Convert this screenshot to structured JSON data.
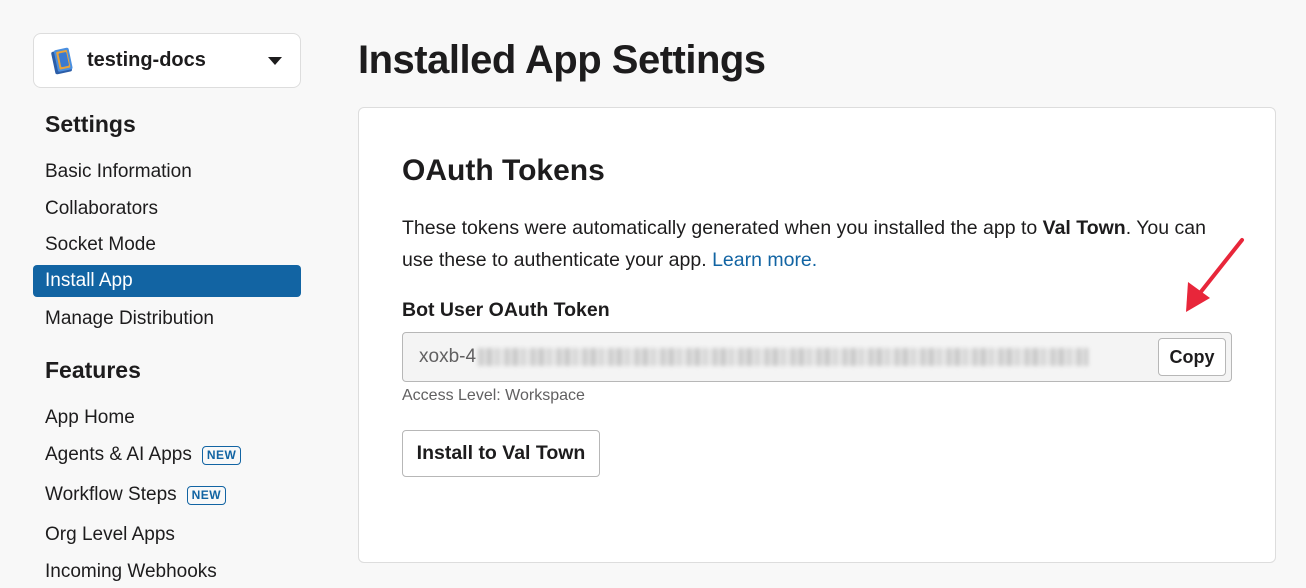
{
  "sidebar": {
    "app_name": "testing-docs",
    "settings_heading": "Settings",
    "settings_items": [
      {
        "label": "Basic Information"
      },
      {
        "label": "Collaborators"
      },
      {
        "label": "Socket Mode"
      },
      {
        "label": "Install App"
      },
      {
        "label": "Manage Distribution"
      }
    ],
    "features_heading": "Features",
    "features_items": [
      {
        "label": "App Home"
      },
      {
        "label": "Agents & AI Apps",
        "badge": "NEW"
      },
      {
        "label": "Workflow Steps",
        "badge": "NEW"
      },
      {
        "label": "Org Level Apps"
      },
      {
        "label": "Incoming Webhooks"
      }
    ],
    "active_item": "Install App"
  },
  "main": {
    "title": "Installed App Settings",
    "card": {
      "title": "OAuth Tokens",
      "desc_before": "These tokens were automatically generated when you installed the app to ",
      "desc_workspace": "Val Town",
      "desc_after": ". You can use these to authenticate your app. ",
      "learn_more": "Learn more.",
      "token_label": "Bot User OAuth Token",
      "token_prefix": "xoxb-4",
      "copy_label": "Copy",
      "access_level": "Access Level: Workspace",
      "install_label": "Install to Val Town"
    }
  },
  "colors": {
    "accent": "#1264a3",
    "annotation_arrow": "#e8263a"
  },
  "icons": {
    "app": "book-icon",
    "dropdown": "caret-down-icon"
  }
}
